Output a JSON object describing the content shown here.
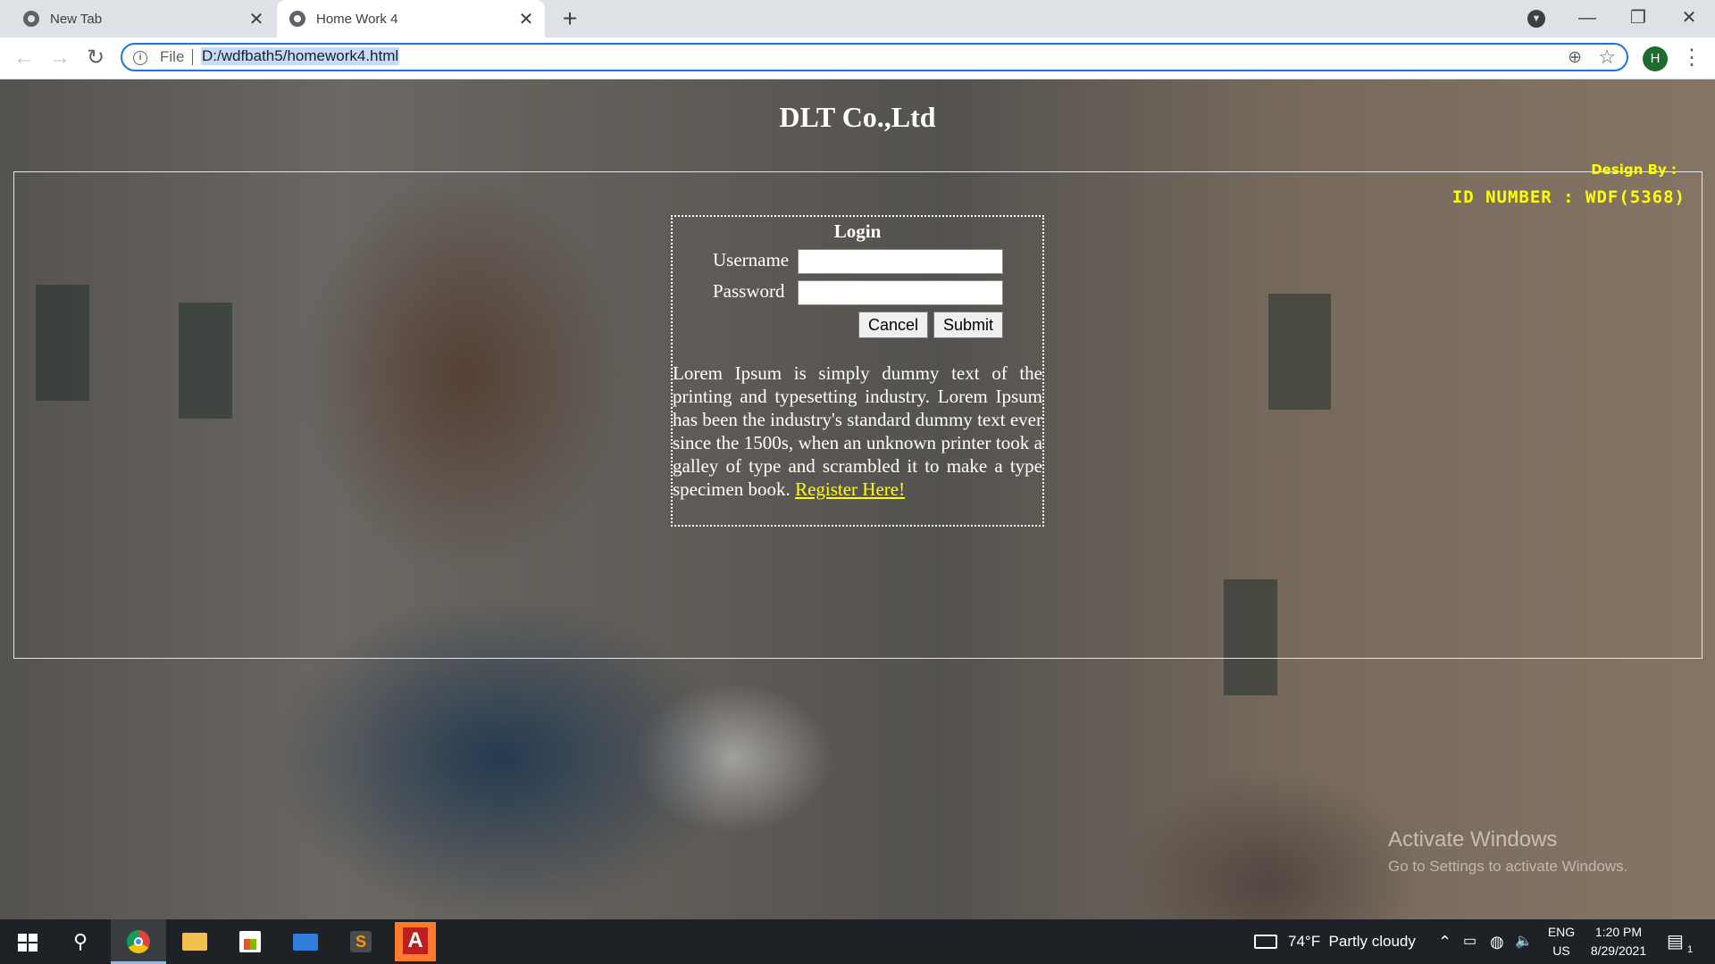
{
  "browser": {
    "tabs": [
      {
        "title": "New Tab",
        "active": false
      },
      {
        "title": "Home Work 4",
        "active": true
      }
    ],
    "new_tab_label": "+",
    "address": {
      "scheme": "File",
      "url": "D:/wdfbath5/homework4.html"
    },
    "profile_initial": "H"
  },
  "page": {
    "company_title": "DLT Co.,Ltd",
    "design_by": "Design By :",
    "id_number": "ID NUMBER : WDF(5368)",
    "login": {
      "title": "Login",
      "username_label": "Username",
      "password_label": "Password",
      "username_value": "",
      "password_value": "",
      "cancel_label": "Cancel",
      "submit_label": "Submit",
      "body_text": "Lorem Ipsum is simply dummy text of the printing and typesetting industry. Lorem Ipsum has been the industry's standard dummy text ever since the 1500s, when an unknown printer took a galley of type and scrambled it to make a type specimen book.",
      "register_link": "Register Here!"
    },
    "activation": {
      "title": "Activate Windows",
      "subtitle": "Go to Settings to activate Windows."
    },
    "colors": {
      "accent_yellow": "#ffff00",
      "address_focus": "#1a73e8"
    }
  },
  "taskbar": {
    "apps": [
      "start",
      "search",
      "chrome",
      "file-explorer",
      "store",
      "mail",
      "sublime-text",
      "access"
    ],
    "weather": "74°F  Partly cloudy",
    "language": "ENG",
    "region": "US",
    "time": "1:20 PM",
    "date": "8/29/2021",
    "notification_count": "1"
  }
}
